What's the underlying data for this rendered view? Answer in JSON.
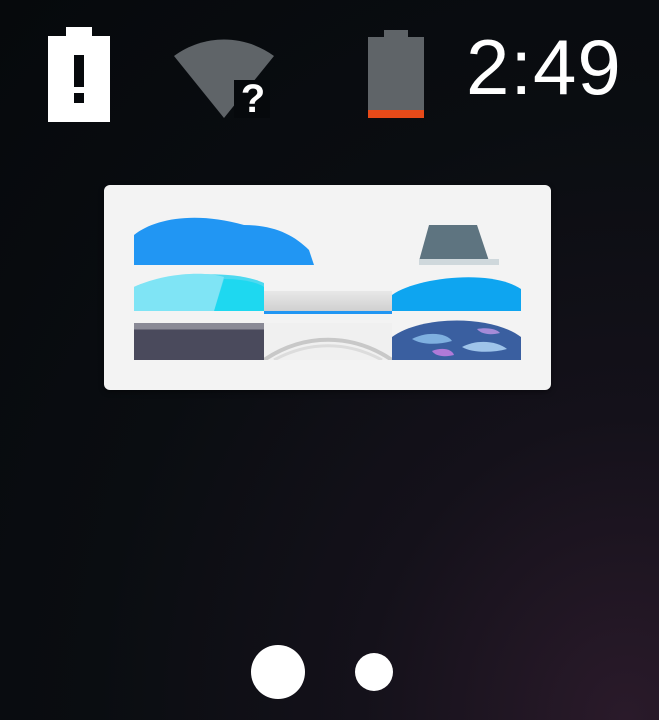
{
  "status_bar": {
    "time": "2:49",
    "icons": [
      "battery-alert-icon",
      "wifi-question-icon",
      "battery-low-icon"
    ],
    "colors": {
      "battery_alert": "#ffffff",
      "wifi": "#5f6468",
      "battery_low_body": "#5f6468",
      "battery_low_level": "#e64a19"
    }
  },
  "app_card": {
    "thumbnails": [
      "cloud-thumbnail",
      "slate-shape-thumbnail",
      "cyan-arc-thumbnail",
      "gray-bar-thumbnail",
      "blue-arc-thumbnail",
      "dark-band-thumbnail",
      "white-curve-thumbnail",
      "globe-thumbnail"
    ],
    "colors": {
      "background": "#f3f3f3",
      "primary_blue": "#2196f3",
      "cyan": "#1ed8f0",
      "slate": "#5e7480"
    }
  },
  "page_indicator": {
    "page_count": 2,
    "active_page": 1
  }
}
